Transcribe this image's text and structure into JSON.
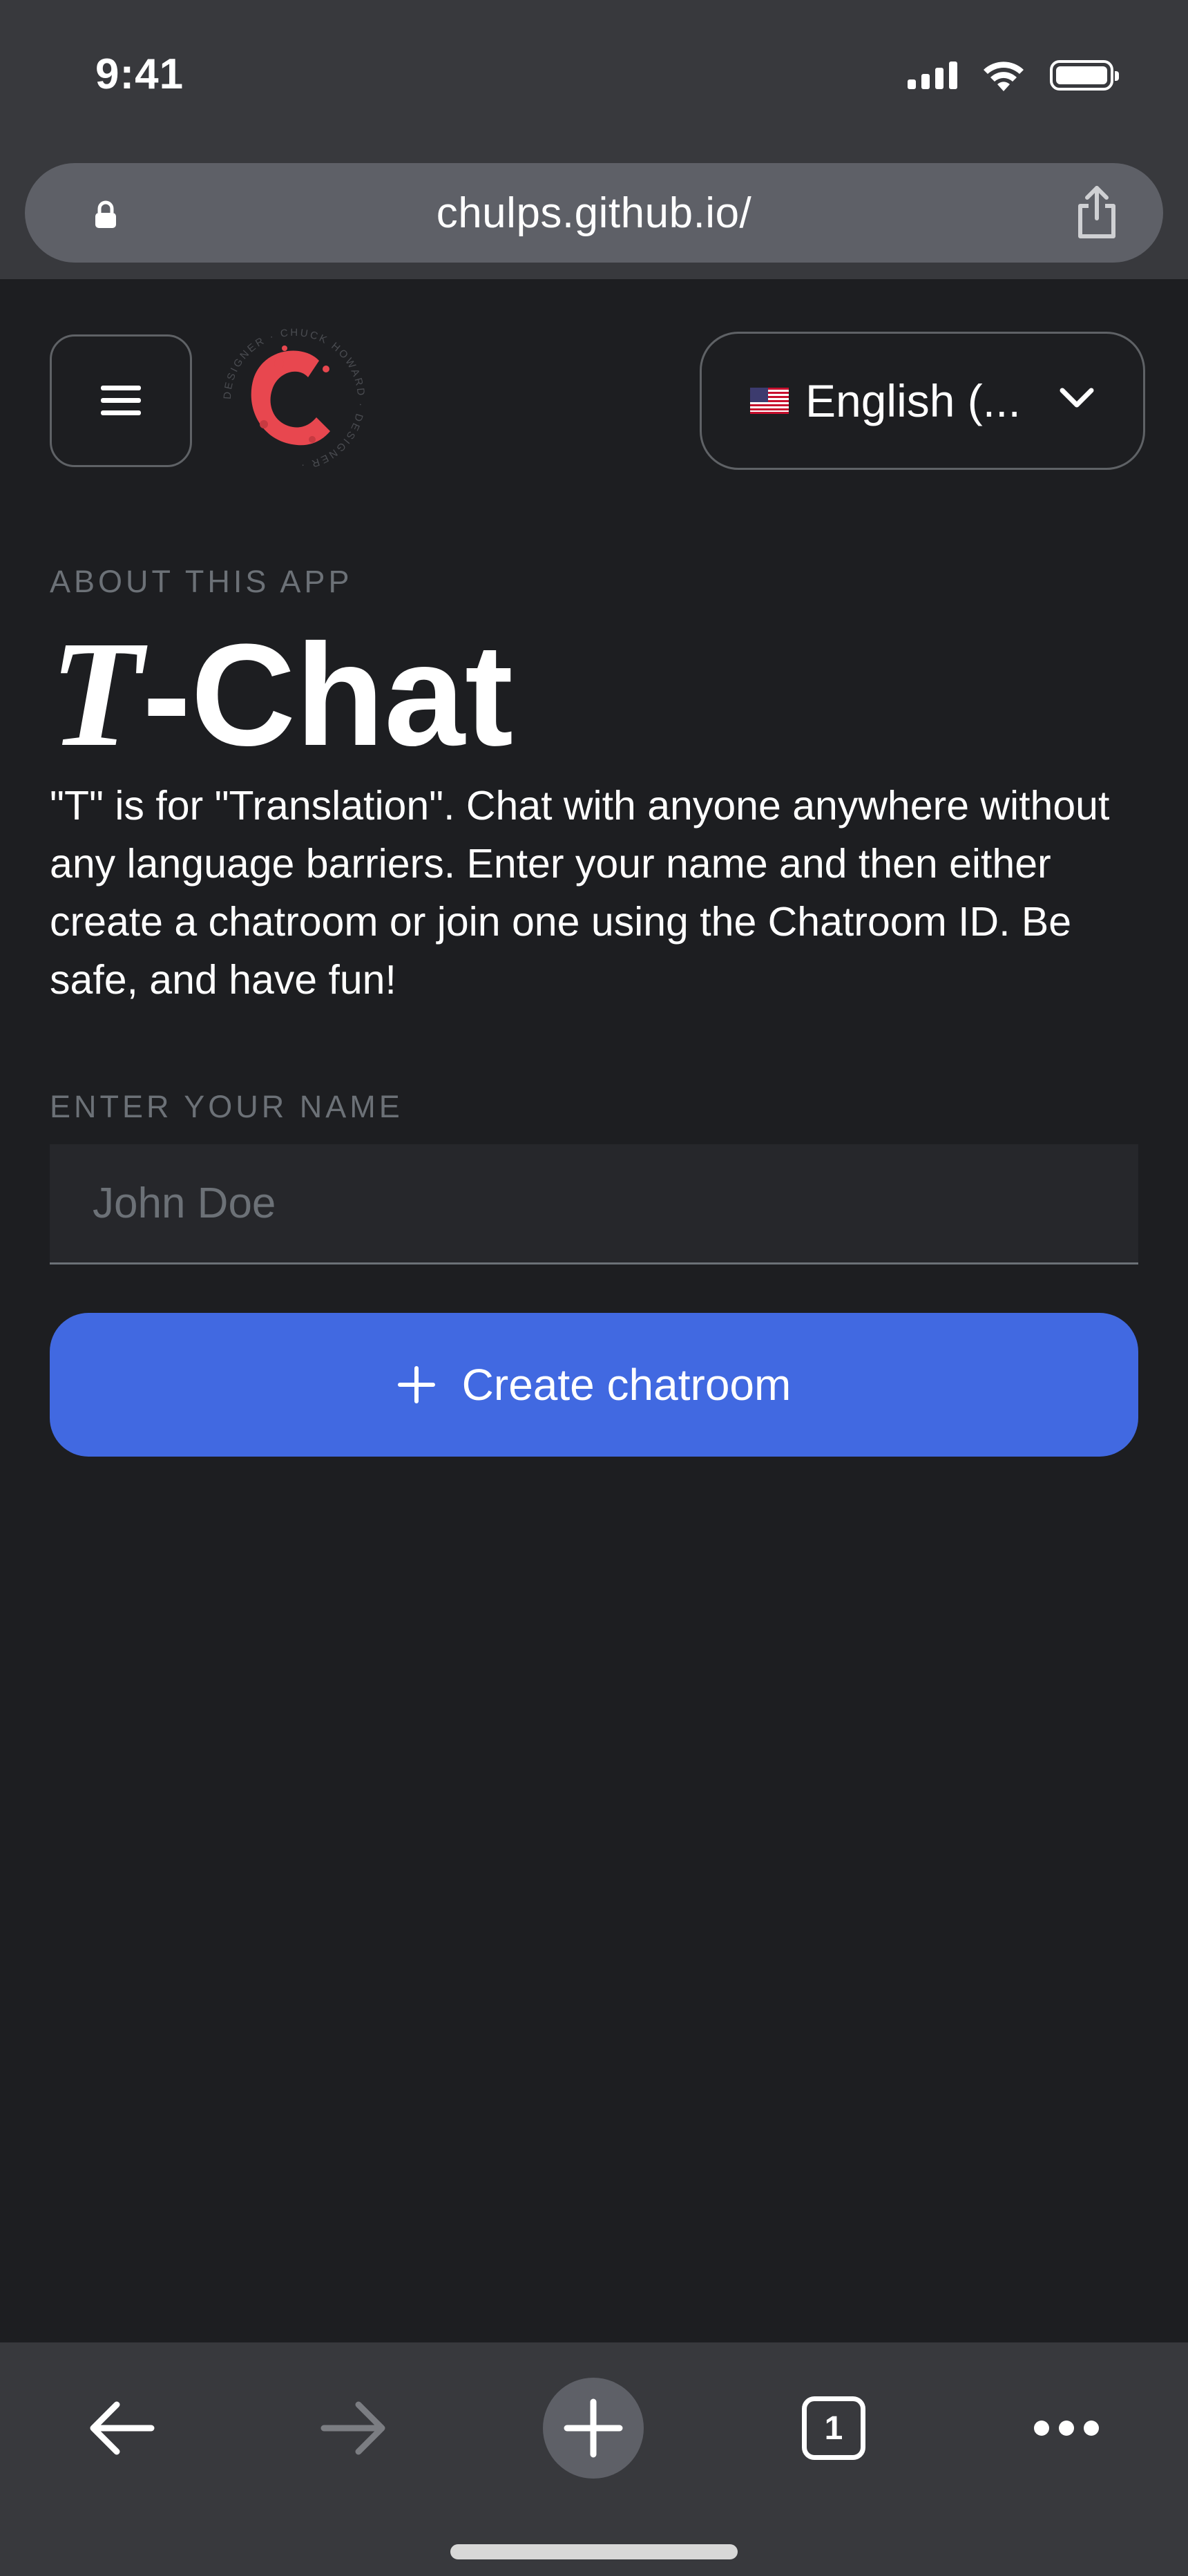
{
  "status_bar": {
    "time": "9:41",
    "icons": [
      "cellular-signal-icon",
      "wifi-icon",
      "battery-icon"
    ]
  },
  "browser": {
    "url": "chulps.github.io/",
    "icons": [
      "lock-icon",
      "share-icon"
    ]
  },
  "header": {
    "menu_icon": "hamburger-icon",
    "logo": {
      "type": "circular-badge",
      "ring_text": "DESIGNER · CHUCK HOWARD · DESIGNER ·",
      "accent_color": "#e8474f"
    },
    "language": {
      "flag": "us-flag-icon",
      "selected_label": "English (...",
      "chevron": "chevron-down-icon"
    }
  },
  "main": {
    "eyebrow": "ABOUT THIS APP",
    "title_t": "T",
    "title_rest": "-Chat",
    "description": "\"T\" is for \"Translation\". Chat with anyone anywhere without any language barriers. Enter your name and then either create a chatroom or join one using the Chatroom ID. Be safe, and have fun!",
    "name_label": "ENTER YOUR NAME",
    "name_input": {
      "value": "",
      "placeholder": "John Doe"
    },
    "create_button": {
      "icon": "plus-icon",
      "label": "Create chatroom"
    }
  },
  "toolbar": {
    "items": [
      "back-icon",
      "forward-icon",
      "new-tab-icon",
      "tabs-icon",
      "more-icon"
    ],
    "tab_count": "1"
  },
  "colors": {
    "page_background": "#1d1e21",
    "chrome_background": "#38393d",
    "url_bar": "#5e6067",
    "accent_blue": "#4169e1",
    "muted_text": "#6c7177",
    "border": "#5f6266",
    "logo_red": "#e8474f"
  }
}
